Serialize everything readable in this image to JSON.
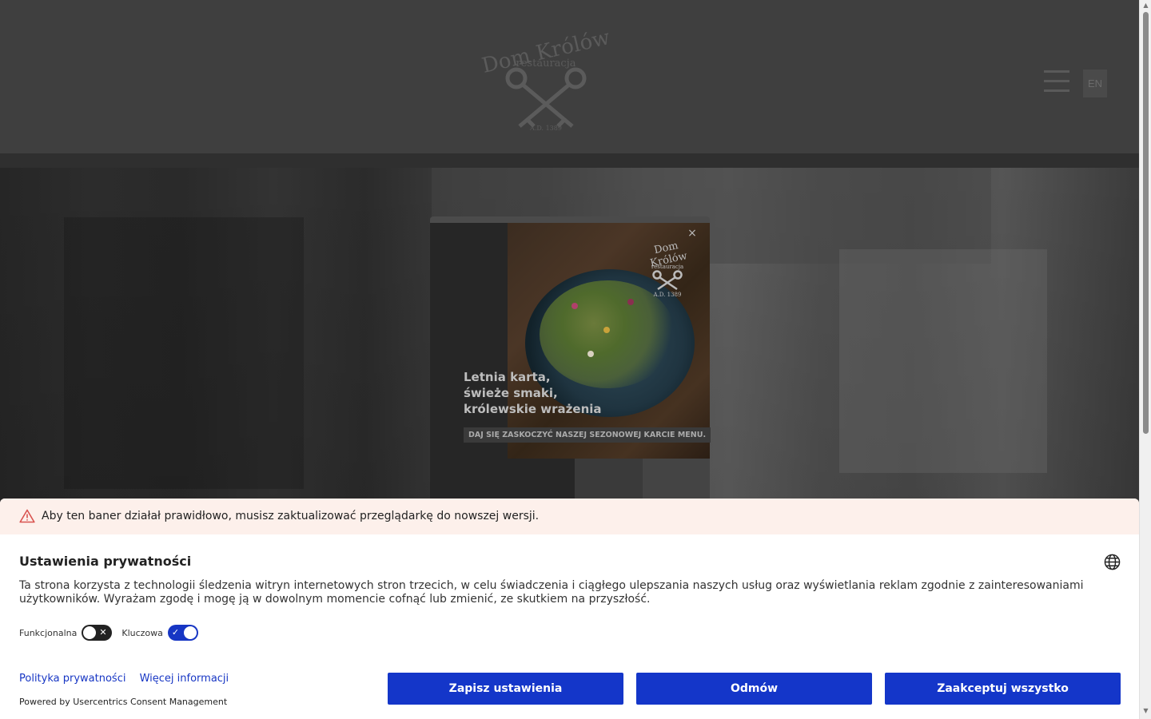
{
  "header": {
    "logo": {
      "name": "Dom Królów",
      "subtitle": "restauracja",
      "year": "A.D. 1389"
    },
    "menu_icon": "hamburger-icon",
    "language_button": "EN"
  },
  "promo": {
    "logo_name": "Dom Królów",
    "logo_subtitle": "restauracja",
    "logo_year": "A.D. 1389",
    "close_label": "×",
    "headline_lines": [
      "Letnia karta,",
      "świeże smaki,",
      "królewskie wrażenia"
    ],
    "subline": "DAJ SIĘ ZASKOCZYĆ NASZEJ SEZONOWEJ KARCIE MENU."
  },
  "consent": {
    "warning_text": "Aby ten baner działał prawidłowo, musisz zaktualizować przeglądarkę do nowszej wersji.",
    "title": "Ustawienia prywatności",
    "description": "Ta strona korzysta z technologii śledzenia witryn internetowych stron trzecich, w celu świadczenia i ciągłego ulepszania naszych usług oraz wyświetlania reklam zgodnie z zainteresowaniami użytkowników. Wyrażam zgodę i mogę ją w dowolnym momencie cofnąć lub zmienić, ze skutkiem na przyszłość.",
    "toggles": [
      {
        "label": "Funkcjonalna",
        "state": "off"
      },
      {
        "label": "Kluczowa",
        "state": "on"
      }
    ],
    "links": [
      "Polityka prywatności",
      "Więcej informacji"
    ],
    "powered_by": "Powered by Usercentrics Consent Management",
    "buttons": {
      "save": "Zapisz ustawienia",
      "deny": "Odmów",
      "accept": "Zaakceptuj wszystko"
    },
    "accent_color": "#1436c9",
    "warning_bg": "#fdf0eb"
  }
}
